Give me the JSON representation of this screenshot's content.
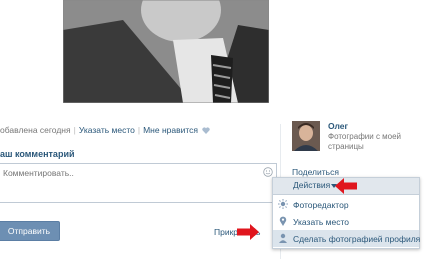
{
  "post": {
    "added_text": "обавлена сегодня",
    "specify_place": "Указать место",
    "like": "Мне нравится"
  },
  "comment": {
    "title": "аш комментарий",
    "placeholder": "Комментировать..",
    "send": "Отправить",
    "attach": "Прикрепить"
  },
  "owner": {
    "name": "Олег",
    "description": "Фотографии с моей страницы"
  },
  "share_label": "Поделиться",
  "actions_menu": {
    "label": "Действия",
    "items": [
      {
        "label": "Фоторедактор",
        "icon": "sun-icon"
      },
      {
        "label": "Указать место",
        "icon": "map-pin-icon"
      },
      {
        "label": "Сделать фотографией профиля",
        "icon": "person-icon"
      }
    ]
  },
  "colors": {
    "link": "#2b587a",
    "button": "#6d8fb3",
    "arrow": "#e0161e"
  }
}
